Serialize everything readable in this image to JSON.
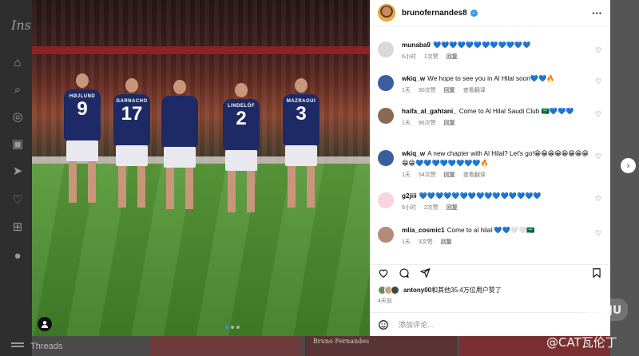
{
  "background": {
    "logo_text": "Inst",
    "threads_label": "Threads",
    "strip_caption": "Bruno Fernandes"
  },
  "post": {
    "username": "brunofernandes8",
    "media": {
      "players": [
        {
          "name": "HØJLUND",
          "number": "9"
        },
        {
          "name": "GARNACHO",
          "number": "17"
        },
        {
          "name": "",
          "number": ""
        },
        {
          "name": "LINDELÖF",
          "number": "2"
        },
        {
          "name": "MAZRAOUI",
          "number": "3"
        }
      ],
      "carousel_index": 1,
      "carousel_count": 3
    },
    "comments": [
      {
        "user": "munaba9",
        "text": "💙💙💙💙💙💙💙💙💙💙💙💙",
        "time": "6小时",
        "replies": "1次赞",
        "reply_label": "回复"
      },
      {
        "user": "wkiq_w",
        "text": "We hope to see you in Al Hilal soon💙💙🔥",
        "time": "1天",
        "replies": "90次赞",
        "reply_label": "回复",
        "extra": "查看翻译"
      },
      {
        "user": "haifa_al_gahtani_",
        "text": "Come to Al Hilal Saudi Club 🇸🇦💙💙💙",
        "time": "1天",
        "replies": "96次赞",
        "reply_label": "回复"
      },
      {
        "user": "wkiq_w",
        "text": "A new chapter with Al Hilal? Let's go!😁😁😁😁😁😁😁😁😁😁💙💙💙💙💙💙💙💙🔥",
        "time": "1天",
        "replies": "54次赞",
        "reply_label": "回复",
        "extra": "查看翻译"
      },
      {
        "user": "g2jiii",
        "text": "💙💙💙💙💙💙💙💙💙💙💙💙💙💙💙",
        "time": "6小时",
        "replies": "2次赞",
        "reply_label": "回复"
      },
      {
        "user": "mlia_cosmic1",
        "text": "Come to al hilal 💙💙🤍🤍🇸🇦",
        "time": "1天",
        "replies": "3次赞",
        "reply_label": "回复"
      }
    ],
    "likes": {
      "user": "antony00",
      "rest": "和其他35.4万位用户赞了"
    },
    "time_ago": "4天前",
    "add_comment_placeholder": "添加评论..."
  },
  "watermark": {
    "logo": "简单JU",
    "text": "@CAT瓦伦丁"
  },
  "colors": {
    "jersey": "#1d2a66",
    "verified": "#3897f0",
    "pitch": "#4f8a2e"
  },
  "icons": {
    "like": "heart-icon",
    "comment": "comment-icon",
    "share": "send-icon",
    "save": "bookmark-icon",
    "emoji": "emoji-icon",
    "more": "more-icon",
    "next": "chevron-right-icon"
  }
}
